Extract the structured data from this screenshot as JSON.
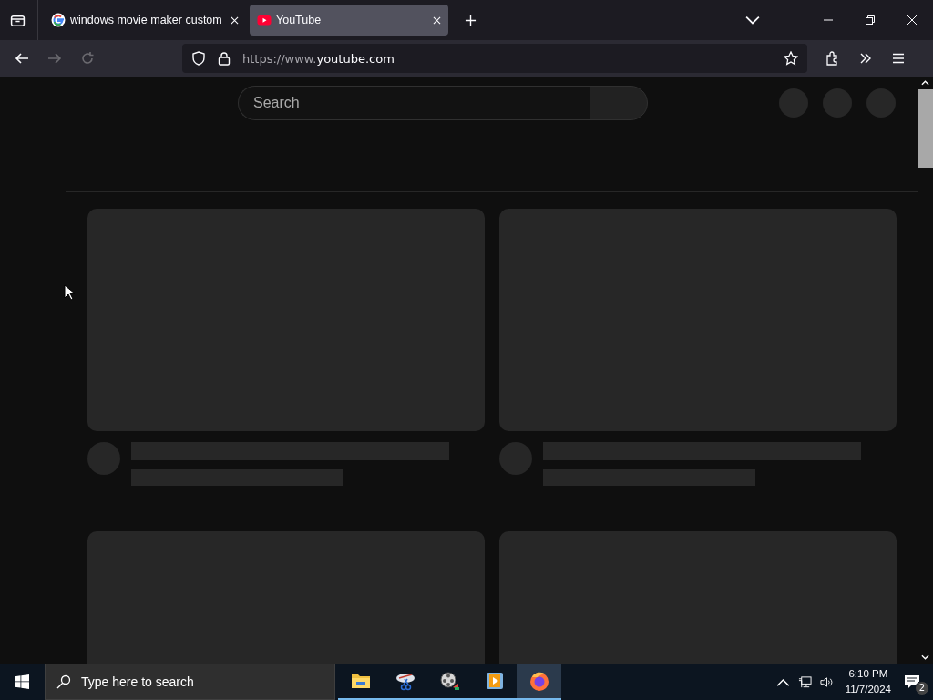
{
  "tabs": [
    {
      "title": "windows movie maker custom",
      "kind": "google",
      "selected": false
    },
    {
      "title": "YouTube",
      "kind": "youtube",
      "selected": true
    }
  ],
  "address_bar": {
    "prefix": "https://www.",
    "domain": "youtube.com"
  },
  "page": {
    "search": {
      "placeholder": "Search"
    }
  },
  "taskbar": {
    "search": {
      "placeholder": "Type here to search"
    },
    "apps": [
      {
        "kind": "folder",
        "selected": false
      },
      {
        "kind": "snipping",
        "selected": false
      },
      {
        "kind": "film",
        "selected": false
      },
      {
        "kind": "player",
        "selected": false
      },
      {
        "kind": "firefox",
        "selected": true
      }
    ],
    "clock": {
      "time": "6:10 PM",
      "date": "11/7/2024"
    },
    "notifications": {
      "count": "2"
    }
  }
}
